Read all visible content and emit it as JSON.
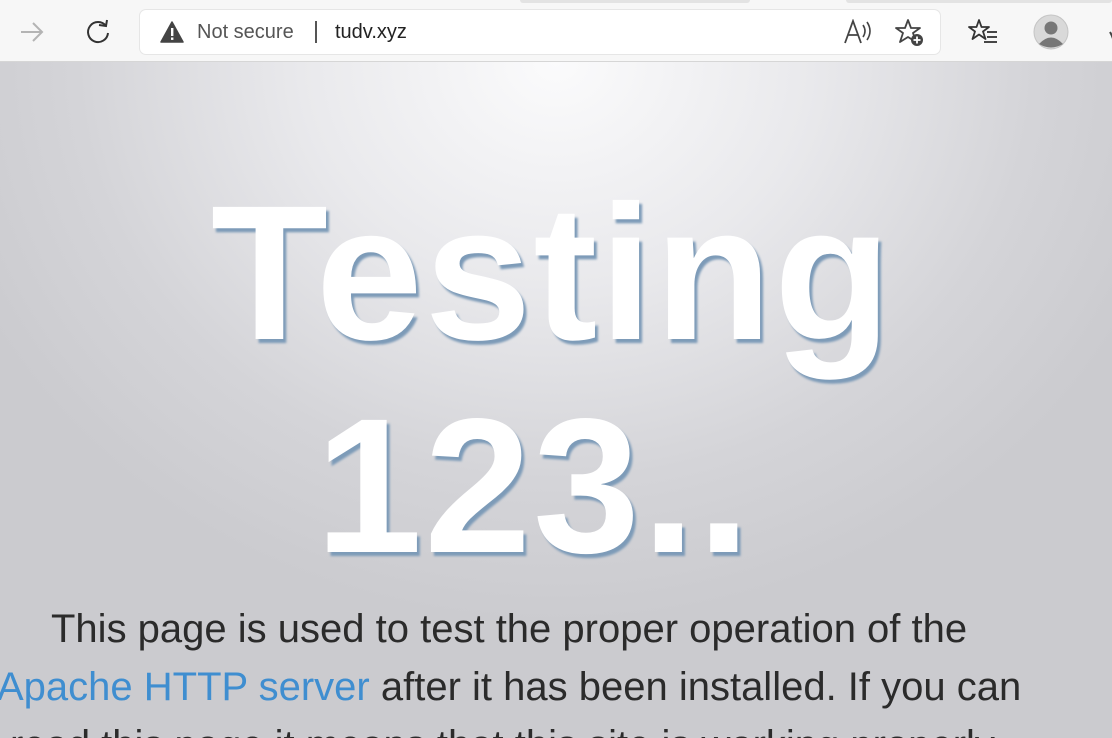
{
  "browser": {
    "back_icon": "arrow-right-icon",
    "refresh_icon": "refresh-icon",
    "address": {
      "security_label": "Not secure",
      "url": "tudv.xyz"
    },
    "read_aloud_icon": "read-aloud-icon",
    "add_favorite_icon": "star-plus-icon",
    "favorites_icon": "favorites-list-icon",
    "profile_icon": "profile-avatar-icon"
  },
  "page": {
    "heading_line1": "Testing",
    "heading_line2": "123..",
    "paragraph": {
      "line1": "This page is used to test the proper operation of the",
      "link_text": "Apache HTTP server",
      "line2_rest": " after it has been installed. If you can",
      "line3": "read this page it means that this site is working properly."
    },
    "colors": {
      "link": "#3f8ed0",
      "heading_shadow": "#7d9bb8"
    }
  }
}
